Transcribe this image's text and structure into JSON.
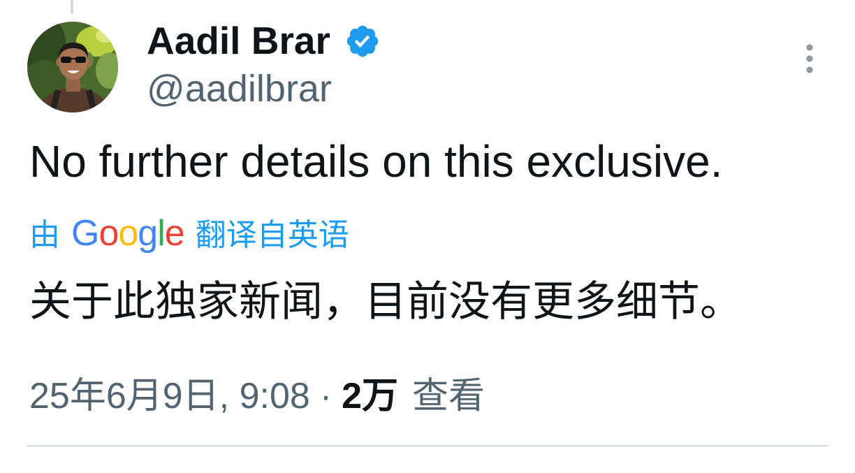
{
  "tweet": {
    "author": {
      "name": "Aadil Brar",
      "handle": "@aadilbrar",
      "verified": true
    },
    "text": "No further details on this exclusive.",
    "translation": {
      "prefix": "由",
      "brand": "Google",
      "suffix": "翻译自英语",
      "text": "关于此独家新闻，目前没有更多细节。"
    },
    "meta": {
      "date": "25年6月9日, 9:08",
      "separator": "·",
      "views_count": "2万",
      "views_label": "查看"
    }
  },
  "icons": {
    "verified": "verified-badge-icon",
    "more": "more-vertical-icon",
    "avatar": "profile-photo"
  },
  "colors": {
    "text": "#0f1419",
    "secondary": "#536471",
    "accent": "#1d9bf0",
    "divider": "#cfd9de",
    "icon": "#8b98a5",
    "google_logo": [
      "#4285F4",
      "#EA4335",
      "#FBBC05",
      "#4285F4",
      "#34A853",
      "#EA4335"
    ]
  }
}
